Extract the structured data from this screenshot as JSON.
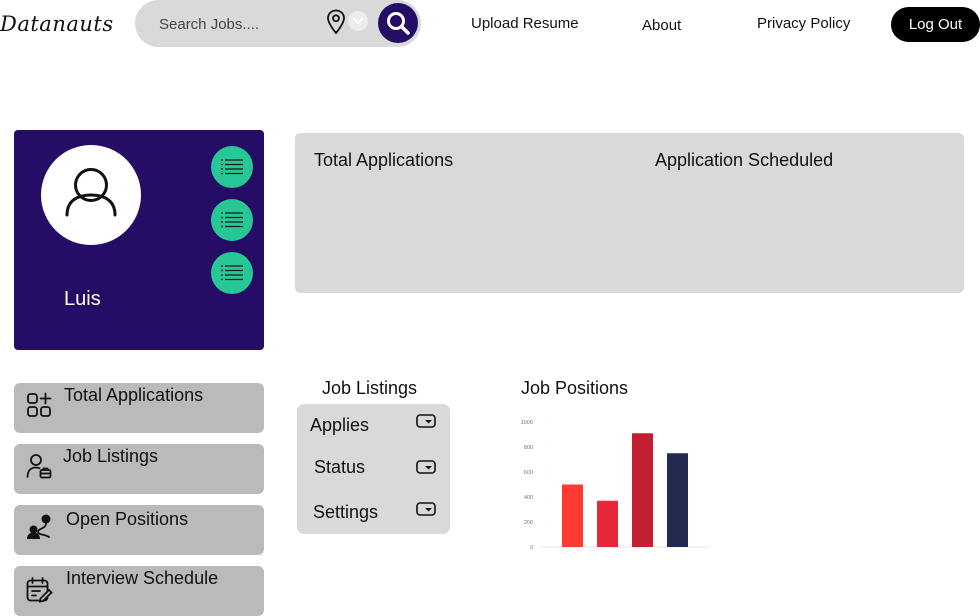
{
  "brand": {
    "logo_text": "Datanauts"
  },
  "search": {
    "placeholder": "Search Jobs...."
  },
  "nav": {
    "upload_resume": "Upload Resume",
    "about": "About",
    "privacy_policy": "Privacy Policy",
    "logout": "Log Out"
  },
  "profile": {
    "name": "Luis"
  },
  "stats": {
    "total_applications": "Total Applications",
    "application_scheduled": "Application Scheduled"
  },
  "sidebar": {
    "items": [
      {
        "label": "Total Applications",
        "icon": "apps-add-icon"
      },
      {
        "label": "Job Listings",
        "icon": "user-briefcase-icon"
      },
      {
        "label": "Open Positions",
        "icon": "user-route-icon"
      },
      {
        "label": "Interview Schedule",
        "icon": "calendar-edit-icon"
      }
    ]
  },
  "job_listings": {
    "title": "Job Listings",
    "items": [
      {
        "label": "Applies"
      },
      {
        "label": "Status"
      },
      {
        "label": "Settings"
      }
    ]
  },
  "job_positions": {
    "title": "Job Positions"
  },
  "chart_data": {
    "type": "bar",
    "title": "",
    "xlabel": "",
    "ylabel": "",
    "ylim": [
      0,
      1000
    ],
    "yticks": [
      "0",
      "200",
      "400",
      "600",
      "800",
      "1000"
    ],
    "values": [
      500,
      370,
      910,
      750
    ],
    "colors": [
      "#ff3b30",
      "#e4283a",
      "#c41e32",
      "#222b4f"
    ]
  }
}
